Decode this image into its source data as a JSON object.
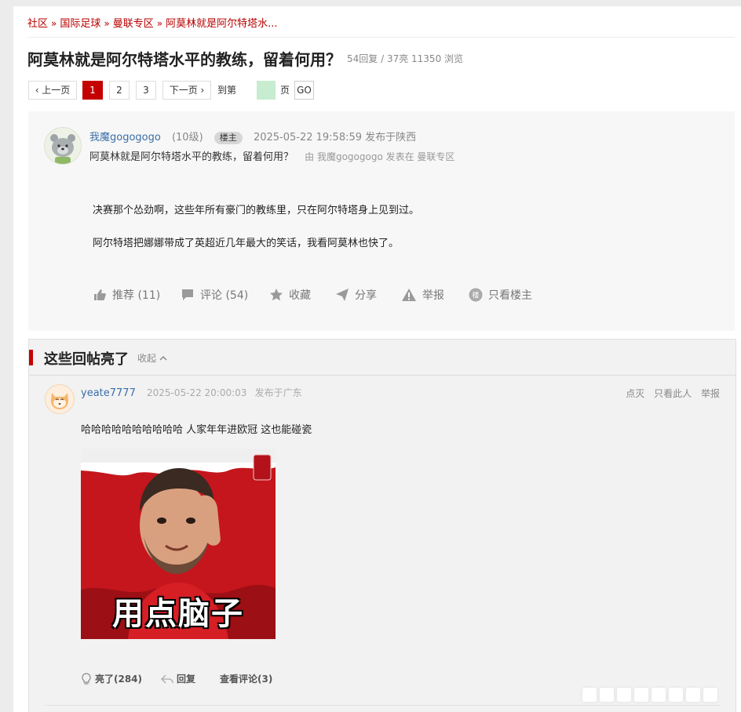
{
  "breadcrumb": [
    "社区",
    "国际足球",
    "曼联专区",
    "阿莫林就是阿尔特塔水..."
  ],
  "breadcrumb_sep": "»",
  "thread": {
    "title": "阿莫林就是阿尔特塔水平的教练，留着何用？",
    "stats": "54回复 / 37亮 11350 浏览"
  },
  "pager": {
    "prev": "‹ 上一页",
    "pages": [
      "1",
      "2",
      "3"
    ],
    "current": "1",
    "next": "下一页 ›",
    "goto_prefix": "到第",
    "goto_suffix": "页",
    "go": "GO"
  },
  "op": {
    "username": "我魔gogogogo",
    "level": "(10级)",
    "badge": "楼主",
    "time": "2025-05-22 19:58:59 发布于陕西",
    "subtitle": "阿莫林就是阿尔特塔水平的教练，留着何用？",
    "from": "由 我魔gogogogo 发表在 曼联专区",
    "body": [
      "决赛那个怂劲啊，这些年所有豪门的教练里，只在阿尔特塔身上见到过。",
      "阿尔特塔把娜娜带成了英超近几年最大的笑话，我看阿莫林也快了。"
    ],
    "actions": {
      "recommend": "推荐 (11)",
      "comment": "评论 (54)",
      "favorite": "收藏",
      "share": "分享",
      "report": "举报",
      "only_op": "只看楼主"
    },
    "only_op_icon_text": "楼"
  },
  "highlights": {
    "title": "这些回帖亮了",
    "collapse": "收起",
    "reply": {
      "username": "yeate7777",
      "time": "2025-05-22 20:00:03",
      "location": "发布于广东",
      "ops": [
        "点灭",
        "只看此人",
        "举报"
      ],
      "text": "哈哈哈哈哈哈哈哈哈哈 人家年年进欧冠 这也能碰瓷",
      "image_caption": "用点脑子",
      "actions": {
        "light": "亮了(284)",
        "reply": "回复",
        "view_comments": "查看评论(3)"
      }
    }
  },
  "colors": {
    "accent": "#c40000",
    "link": "#3b6ea8",
    "pager_input": "#c8ecd0"
  }
}
